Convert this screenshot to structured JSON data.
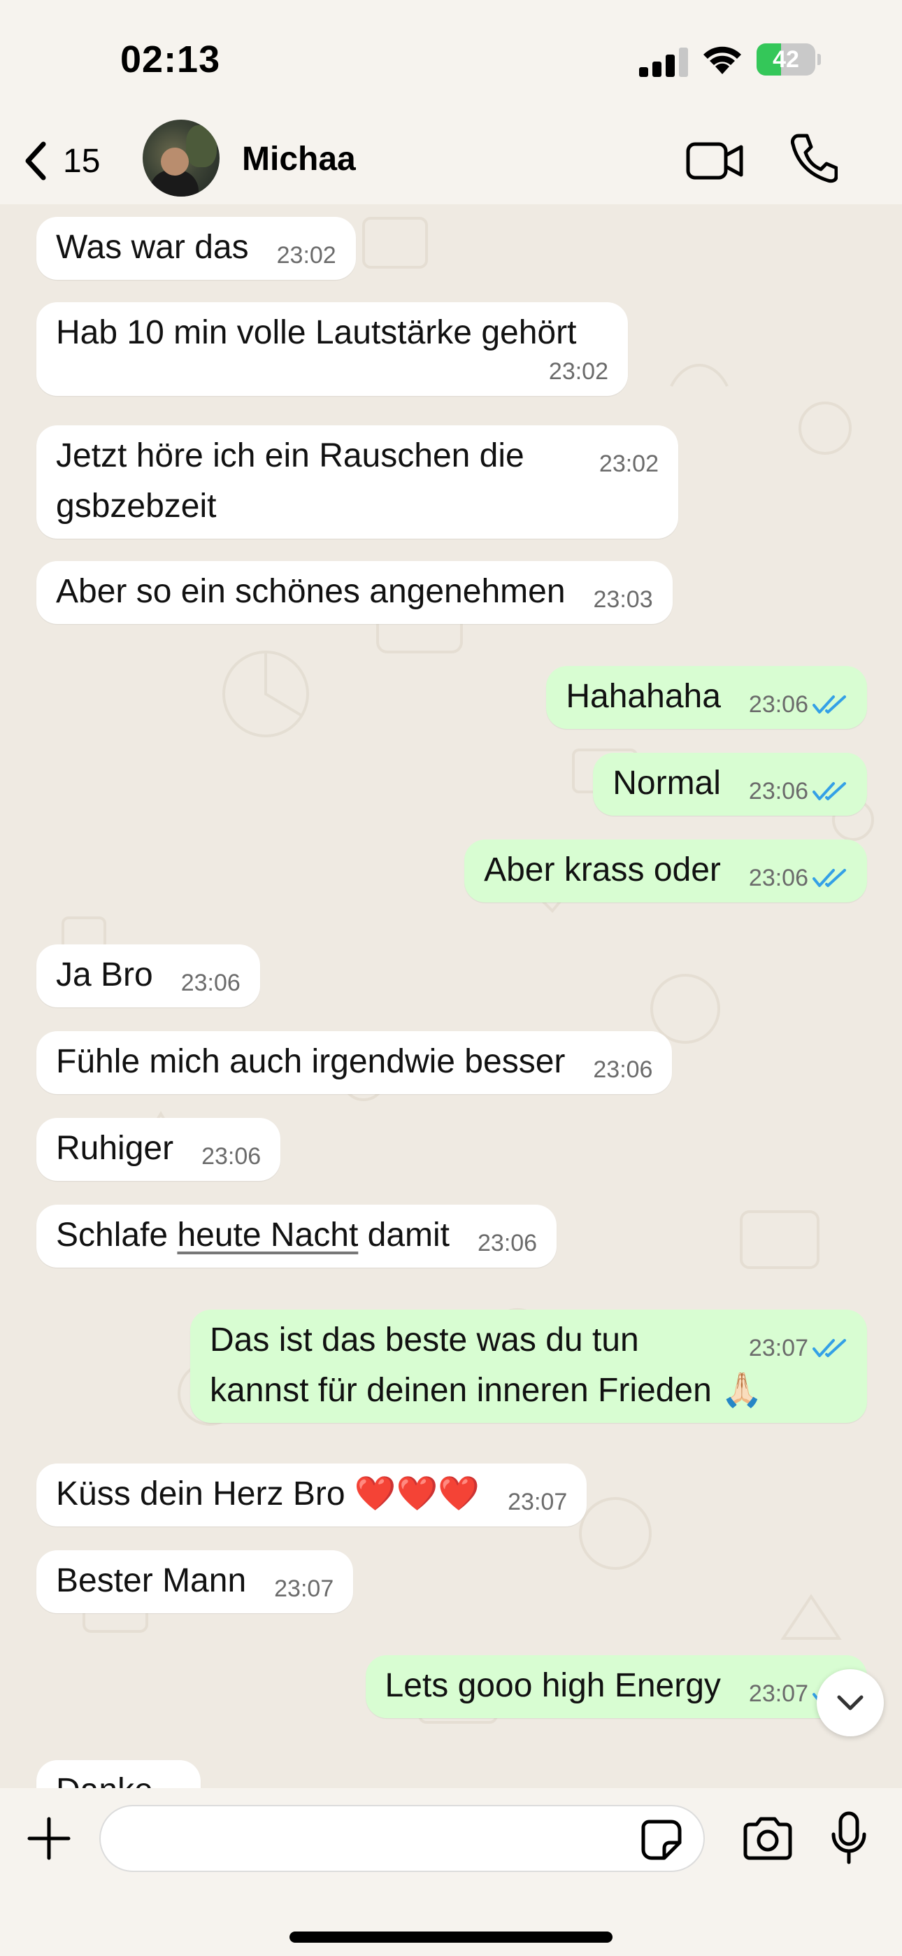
{
  "status_bar": {
    "time": "02:13",
    "battery_level": "42",
    "battery_fraction": 0.42,
    "icons": [
      "signal-icon",
      "wifi-icon",
      "battery-charging-icon"
    ]
  },
  "header": {
    "back_count": "15",
    "contact_name": "Michaa",
    "icons": [
      "chevron-left-icon",
      "video-call-icon",
      "phone-icon"
    ]
  },
  "messages": [
    {
      "dir": "in",
      "text": "Was war das",
      "time": "23:02"
    },
    {
      "dir": "in",
      "text": "Hab 10 min volle Lautstärke gehört",
      "time": "23:02"
    },
    {
      "dir": "in",
      "text": "Jetzt höre ich ein Rauschen die gsbzebzeit",
      "time": "23:02"
    },
    {
      "dir": "in",
      "text": "Aber so ein schönes angenehmen",
      "time": "23:03"
    },
    {
      "dir": "out",
      "text": "Hahahaha",
      "time": "23:06",
      "status": "read"
    },
    {
      "dir": "out",
      "text": "Normal",
      "time": "23:06",
      "status": "read"
    },
    {
      "dir": "out",
      "text": "Aber krass oder",
      "time": "23:06",
      "status": "read"
    },
    {
      "dir": "in",
      "text": "Ja Bro",
      "time": "23:06"
    },
    {
      "dir": "in",
      "text": "Fühle mich auch irgendwie besser",
      "time": "23:06"
    },
    {
      "dir": "in",
      "text": "Ruhiger",
      "time": "23:06"
    },
    {
      "dir": "in",
      "text_before": "Schlafe ",
      "text_link": "heute Nacht",
      "text_after": " damit",
      "time": "23:06"
    },
    {
      "dir": "out",
      "text": "Das ist das beste was du tun kannst für deinen inneren Frieden 🙏🏻",
      "time": "23:07",
      "status": "read"
    },
    {
      "dir": "in",
      "text": "Küss dein Herz Bro ",
      "hearts": "❤️❤️❤️",
      "time": "23:07"
    },
    {
      "dir": "in",
      "text": "Bester Mann",
      "time": "23:07"
    },
    {
      "dir": "out",
      "text": "Lets gooo high Energy",
      "time": "23:07",
      "status": "read"
    },
    {
      "dir": "in",
      "text": "Danke",
      "time": ""
    }
  ],
  "colors": {
    "incoming_bubble": "#ffffff",
    "outgoing_bubble": "#d8fdd2",
    "read_ticks": "#34a0e6",
    "battery_green": "#34c759"
  },
  "input_bar": {
    "placeholder": "",
    "icons": [
      "plus-icon",
      "sticker-icon",
      "camera-icon",
      "microphone-icon"
    ]
  }
}
